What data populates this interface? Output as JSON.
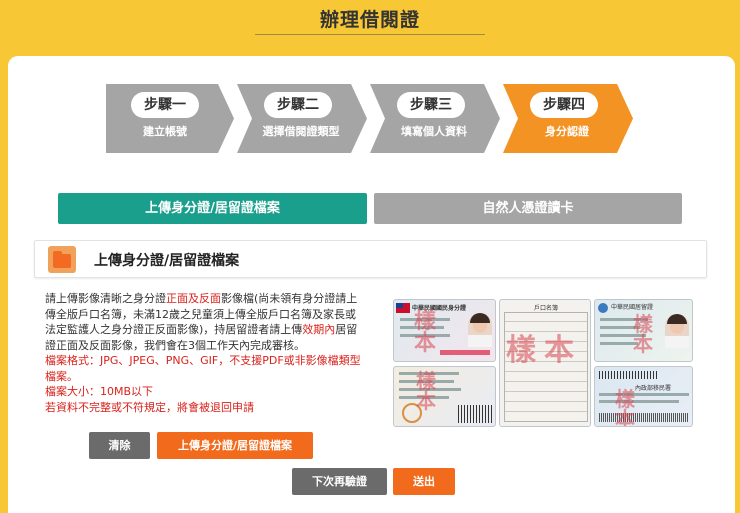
{
  "header": {
    "title": "辦理借閱證"
  },
  "steps": [
    {
      "pill": "步驟一",
      "label": "建立帳號",
      "color": "#a5a5a5"
    },
    {
      "pill": "步驟二",
      "label": "選擇借閱證類型",
      "color": "#a5a5a5"
    },
    {
      "pill": "步驟三",
      "label": "填寫個人資料",
      "color": "#a5a5a5"
    },
    {
      "pill": "步驟四",
      "label": "身分認證",
      "color": "#f39323"
    }
  ],
  "tabs": [
    {
      "label": "上傳身分證/居留證檔案",
      "color": "#1a9f8c",
      "active": true
    },
    {
      "label": "自然人憑證讀卡",
      "color": "#a5a5a5",
      "active": false
    }
  ],
  "section": {
    "title": "上傳身分證/居留證檔案",
    "icon": "folder-icon"
  },
  "instructions": {
    "p1_a": "請上傳影像清晰之身分證",
    "p1_red1": "正面及反面",
    "p1_b": "影像檔(尚未領有身分證請上傳全版戶口名簿，未滿12歲之兒童須上傳全版戶口名簿及家長或法定監護人之身分證正反面影像)，持居留證者請上傳",
    "p1_red2": "效期內",
    "p1_c": "居留證正面及反面影像，我們會在3個工作天內完成審核。",
    "format": "檔案格式：JPG、JPEG、PNG、GIF，不支援PDF或非影像檔類型檔案。",
    "size": "檔案大小：10MB以下",
    "warning": "若資料不完整或不符規定，將會被退回申請"
  },
  "sample_images": {
    "stamp_text": "樣本",
    "id_front_title": "中華民國國民身分證",
    "household_title": "戶口名簿",
    "resident_title": "中華民國居留證",
    "resident_sub": "內政部移民署"
  },
  "buttons": {
    "clear": "清除",
    "upload": "上傳身分證/居留證檔案",
    "verify_later": "下次再驗證",
    "submit": "送出"
  },
  "colors": {
    "orange": "#f26a1b",
    "gray": "#6b6b6b",
    "teal": "#1a9f8c",
    "yellow": "#f7c735"
  }
}
